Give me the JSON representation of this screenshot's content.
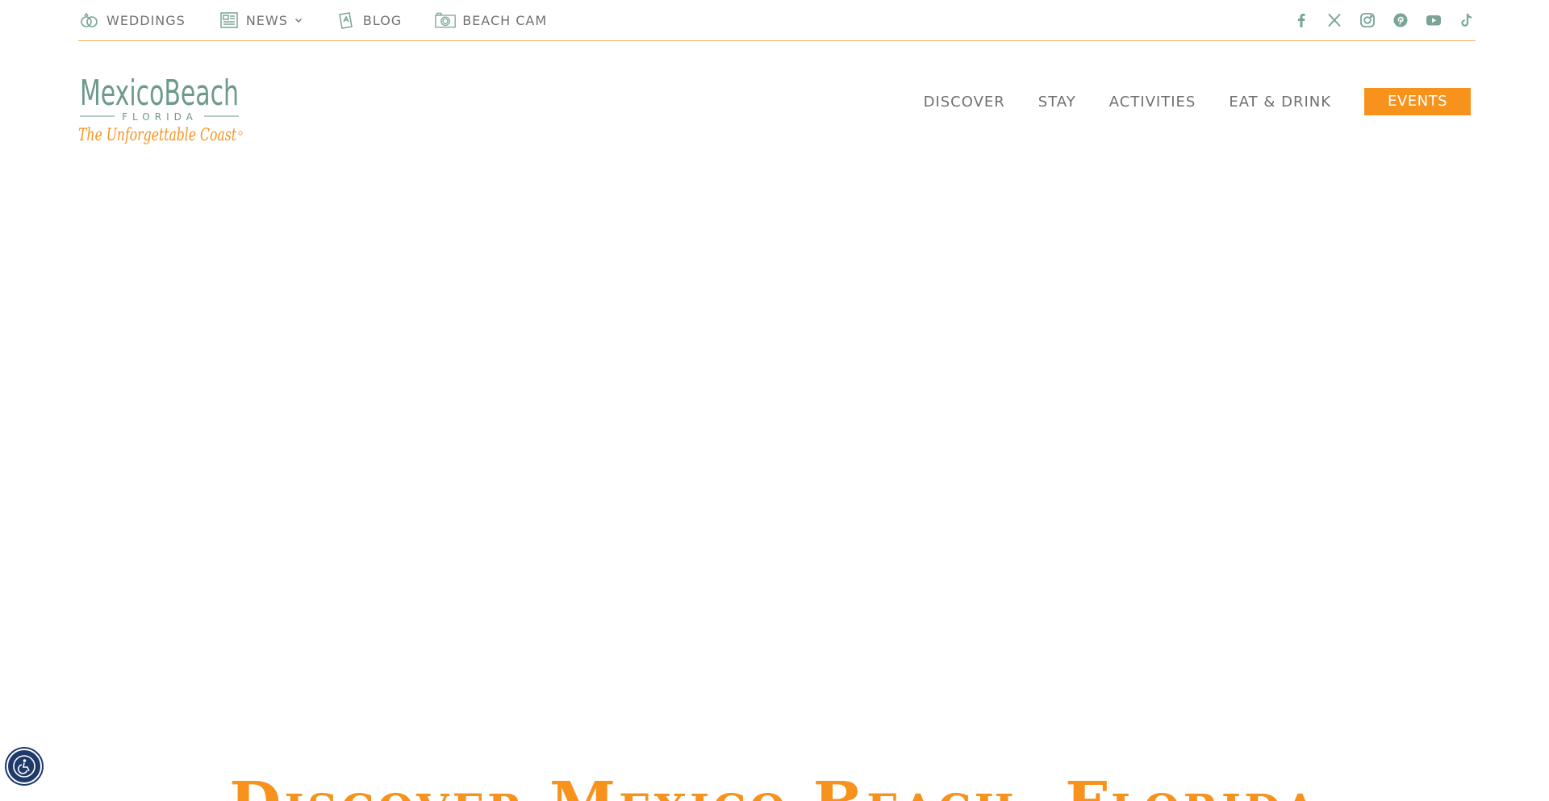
{
  "utility_nav": {
    "items": [
      {
        "label": "WEDDINGS",
        "icon": "rings-icon"
      },
      {
        "label": "NEWS",
        "icon": "newspaper-icon",
        "has_dropdown": true
      },
      {
        "label": "BLOG",
        "icon": "blog-icon"
      },
      {
        "label": "BEACH CAM",
        "icon": "camera-icon"
      }
    ]
  },
  "social": [
    "facebook-icon",
    "x-twitter-icon",
    "instagram-icon",
    "pinterest-icon",
    "youtube-icon",
    "tiktok-icon"
  ],
  "logo": {
    "name": "MexicoBeach",
    "state": "FLORIDA",
    "tagline": "The Unforgettable Coast"
  },
  "main_nav": {
    "items": [
      "DISCOVER",
      "STAY",
      "ACTIVITIES",
      "EAT & DRINK"
    ],
    "events_label": "EVENTS"
  },
  "hero": {
    "heading": "Discover Mexico Beach, Florida"
  },
  "colors": {
    "accent_orange": "#f7931d",
    "brand_green": "#6d9a8a",
    "nav_text": "#6d716f",
    "a11y_blue": "#1f3a6a"
  }
}
